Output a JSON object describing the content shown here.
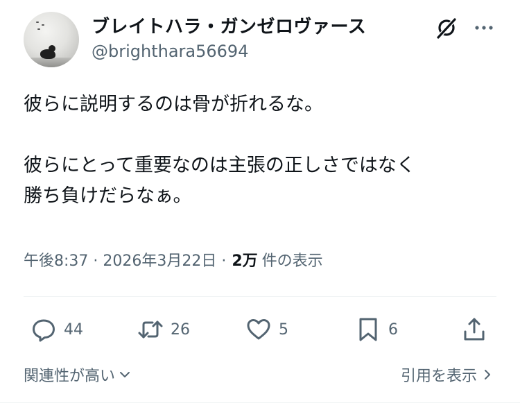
{
  "author": {
    "display_name": "ブレイトハラ・ガンゼロヴァース",
    "handle": "@brighthara56694"
  },
  "tweet": {
    "text": "彼らに説明するのは骨が折れるな。\n\n彼らにとって重要なのは主張の正しさではなく\n勝ち負けだらなぁ。"
  },
  "meta": {
    "timestamp": "午後8:37 · 2026年3月22日 ·",
    "views_count": "2万",
    "views_label": "件の表示"
  },
  "actions": {
    "replies": "44",
    "retweets": "26",
    "likes": "5",
    "bookmarks": "6"
  },
  "footer": {
    "sort_label": "関連性が高い",
    "quotes_label": "引用を表示"
  },
  "icons": {
    "menu": "grok-icon",
    "more": "more-icon",
    "reply": "reply-icon",
    "retweet": "retweet-icon",
    "like": "heart-icon",
    "bookmark": "bookmark-icon",
    "share": "share-icon",
    "sort": "chevron-down-icon",
    "quotes": "chevron-right-icon"
  },
  "colors": {
    "text": "#0f1419",
    "secondary": "#536471",
    "divider": "#eff3f4"
  }
}
